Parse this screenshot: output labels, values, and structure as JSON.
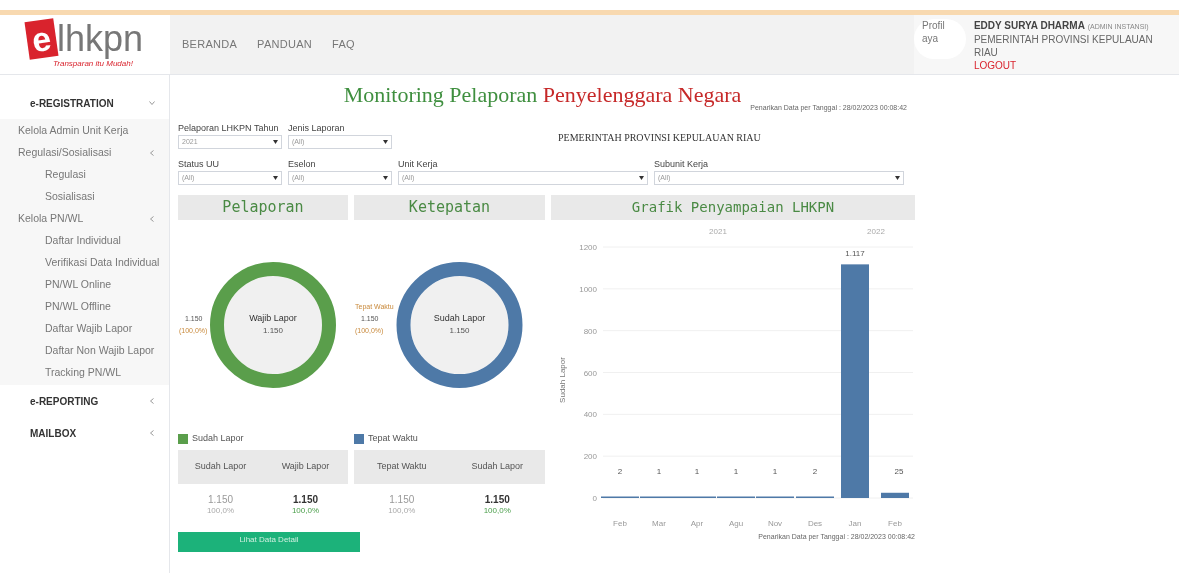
{
  "header": {
    "logo": {
      "mark": "e",
      "word": "lhkpn",
      "tagline": "Transparan itu Mudah!"
    },
    "nav": [
      "BERANDA",
      "PANDUAN",
      "FAQ"
    ],
    "profile_image_alt": [
      "Profil",
      "aya"
    ],
    "user": {
      "name": "EDDY SURYA DHARMA",
      "role": "(ADMIN INSTANSI)",
      "agency": "PEMERINTAH PROVINSI KEPULAUAN RIAU",
      "logout": "LOGOUT"
    }
  },
  "sidebar": {
    "items": [
      {
        "label": "e-REGISTRATION",
        "expanded": true,
        "children": [
          {
            "label": "Kelola Admin Unit Kerja"
          },
          {
            "label": "Regulasi/Sosialisasi",
            "children": [
              {
                "label": "Regulasi"
              },
              {
                "label": "Sosialisasi"
              }
            ]
          },
          {
            "label": "Kelola PN/WL",
            "children": [
              {
                "label": "Daftar Individual"
              },
              {
                "label": "Verifikasi Data Individual"
              },
              {
                "label": "PN/WL Online"
              },
              {
                "label": "PN/WL Offline"
              },
              {
                "label": "Daftar Wajib Lapor"
              },
              {
                "label": "Daftar Non Wajib Lapor"
              },
              {
                "label": "Tracking PN/WL"
              }
            ]
          }
        ]
      },
      {
        "label": "e-REPORTING",
        "expanded": false
      },
      {
        "label": "MAILBOX",
        "expanded": false
      }
    ]
  },
  "dashboard": {
    "title": {
      "main": "Monitoring Pelaporan",
      "accent": "Penyelenggara Negara"
    },
    "timestamp_top": "Penarikan Data per Tanggal : 28/02/2023 00:08:42",
    "agency": "PEMERINTAH PROVINSI KEPULAUAN RIAU",
    "filters_row_1": [
      {
        "label": "Pelaporan LHKPN Tahun",
        "value": "2021"
      },
      {
        "label": "Jenis Laporan",
        "value": "(All)"
      }
    ],
    "filters_row_2": [
      {
        "label": "Status UU",
        "value": "(All)",
        "wide": false
      },
      {
        "label": "Eselon",
        "value": "(All)",
        "wide": false
      },
      {
        "label": "Unit Kerja",
        "value": "(All)",
        "wide": true
      },
      {
        "label": "Subunit Kerja",
        "value": "(All)",
        "wide": true
      }
    ],
    "panels": [
      {
        "title": "Pelaporan",
        "color": "#5a9e4b",
        "side_value": "1.150",
        "side_percent": "(100,0%)",
        "center_label": "Wajib Lapor",
        "center_value": "1.150",
        "legend": "Sudah Lapor",
        "table": {
          "columns": [
            "Sudah Lapor",
            "Wajib Lapor"
          ],
          "cells": [
            {
              "value": "1.150",
              "percent": "100,0%",
              "bold": false
            },
            {
              "value": "1.150",
              "percent": "100,0%",
              "bold": true
            }
          ]
        },
        "button": "Lihat Data Detail"
      },
      {
        "title": "Ketepatan",
        "color": "#4e79a7",
        "side_label": "Tepat Waktu",
        "side_value": "1.150",
        "side_percent": "(100,0%)",
        "center_label": "Sudah Lapor",
        "center_value": "1.150",
        "legend": "Tepat Waktu",
        "table": {
          "columns": [
            "Tepat Waktu",
            "Sudah Lapor"
          ],
          "cells": [
            {
              "value": "1.150",
              "percent": "100,0%",
              "bold": false
            },
            {
              "value": "1.150",
              "percent": "100,0%",
              "bold": true
            }
          ]
        }
      }
    ],
    "graph": {
      "title": "Grafik Penyampaian LHKPN",
      "year_labels": [
        "2021",
        "2022"
      ],
      "chart_data": {
        "type": "bar",
        "ylabel": "Sudah Lapor",
        "categories": [
          "Feb",
          "Mar",
          "Apr",
          "Agu",
          "Nov",
          "Des",
          "Jan",
          "Feb"
        ],
        "series": [
          {
            "color": "#4e79a7",
            "values": [
              2,
              1,
              1,
              1,
              1,
              2,
              1117,
              25
            ]
          }
        ],
        "grid": true,
        "value_labels": [
          "2",
          "1",
          "1",
          "1",
          "1",
          "2",
          "1.117",
          "25"
        ],
        "ylim": [
          0,
          1200
        ],
        "yticks": [
          0,
          200,
          400,
          600,
          800,
          1000,
          1200
        ]
      },
      "timestamp": "Penarikan Data per Tanggal : 28/02/2023 00:08:42"
    }
  }
}
